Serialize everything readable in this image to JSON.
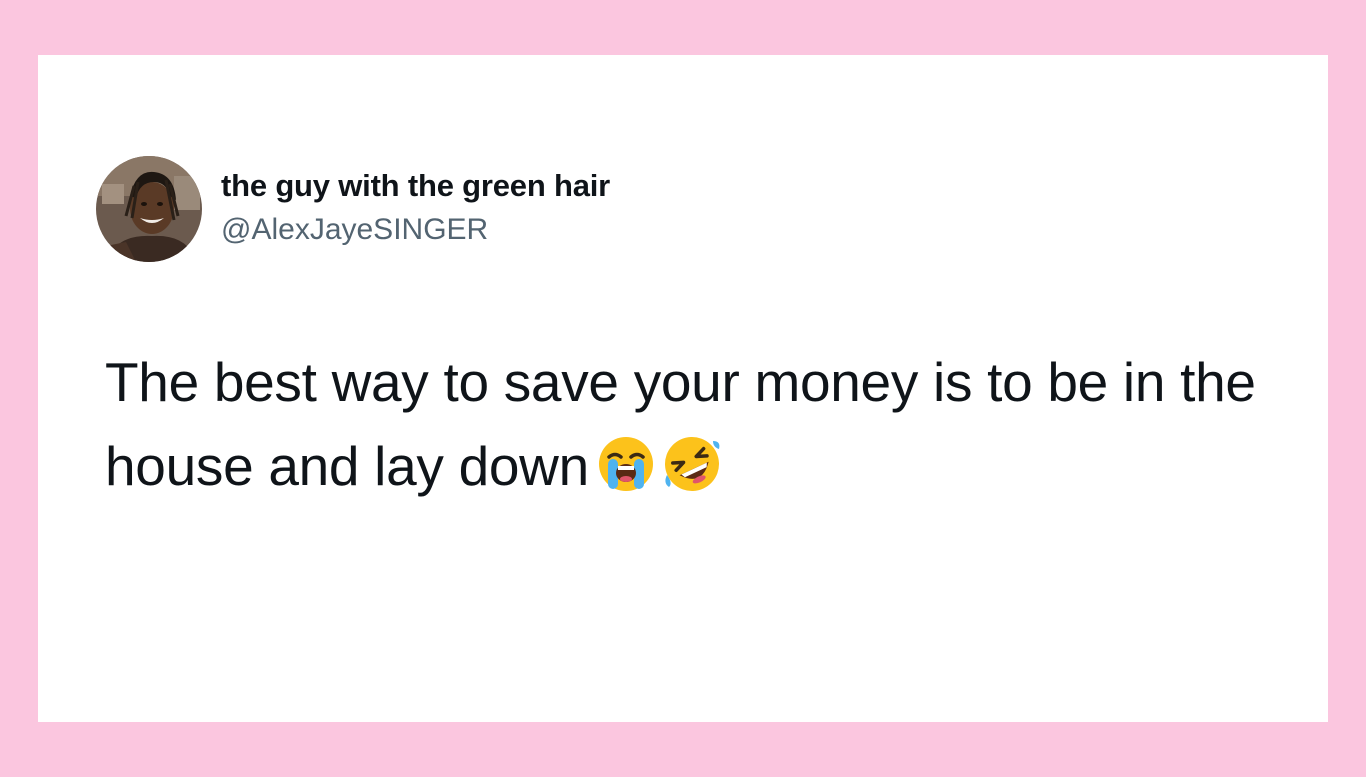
{
  "tweet": {
    "author": {
      "display_name": "the guy with the green hair",
      "handle": "@AlexJayeSINGER",
      "avatar_icon": "profile-photo"
    },
    "text": "The best way to save your money is to be in the house and lay down",
    "emojis": [
      "loudly-crying-face-icon",
      "rolling-on-floor-laughing-icon"
    ]
  },
  "colors": {
    "page_background": "#fbc6df",
    "card_background": "#ffffff",
    "name_text": "#0f1419",
    "handle_text": "#536471",
    "body_text": "#0f1419"
  }
}
